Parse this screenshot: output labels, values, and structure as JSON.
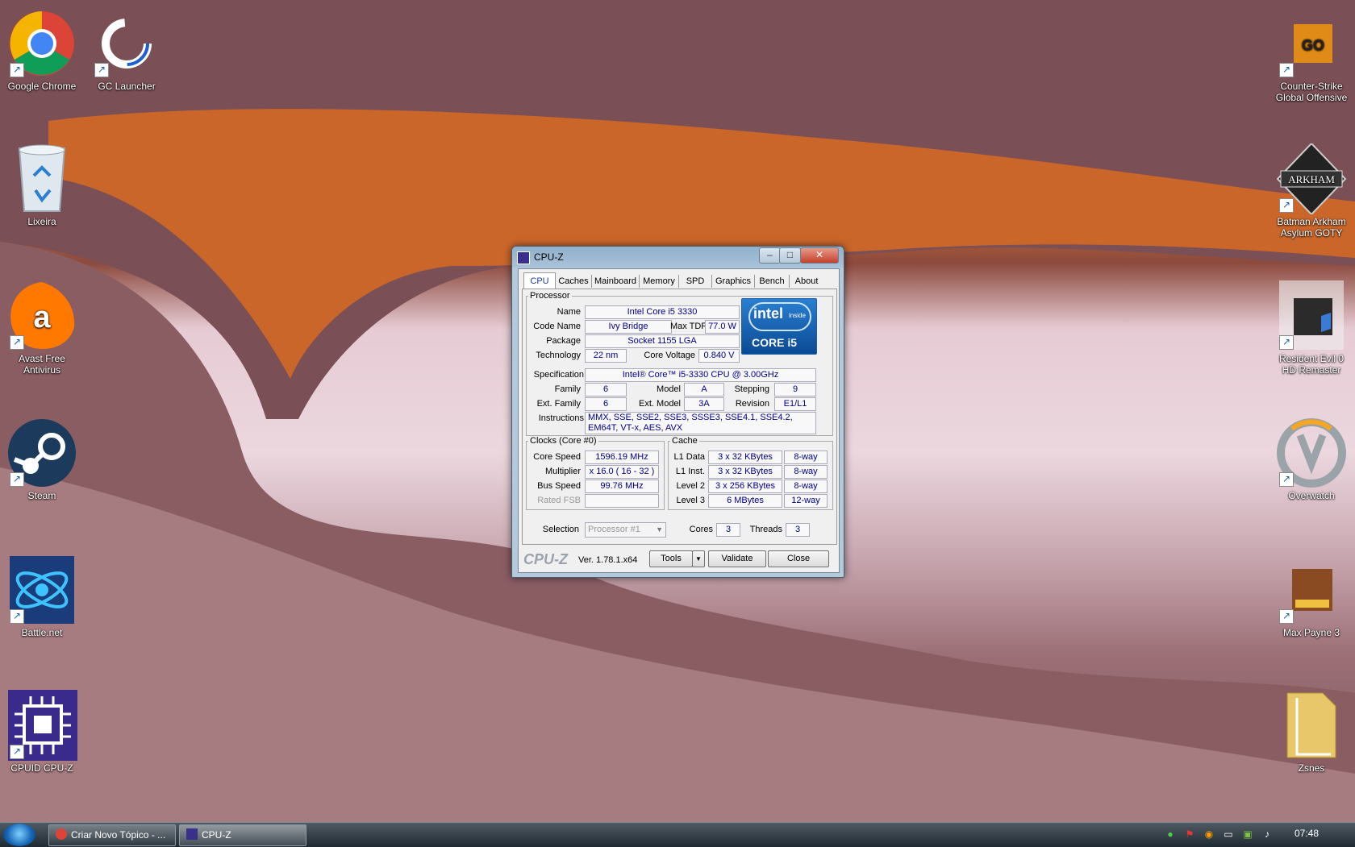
{
  "desktop": {
    "icons_left": [
      {
        "label": "Google Chrome"
      },
      {
        "label": "GC Launcher"
      },
      {
        "label": "Lixeira"
      },
      {
        "label": "Avast Free Antivirus"
      },
      {
        "label": "Steam"
      },
      {
        "label": "Battle.net"
      },
      {
        "label": "CPUID CPU-Z"
      }
    ],
    "icons_right": [
      {
        "label": "Counter-Strike Global Offensive"
      },
      {
        "label": "Batman Arkham Asylum GOTY"
      },
      {
        "label": "Resident Evil 0 HD Remaster"
      },
      {
        "label": "Overwatch"
      },
      {
        "label": "Max Payne 3"
      },
      {
        "label": "Zsnes"
      }
    ]
  },
  "window": {
    "title": "CPU-Z",
    "tabs": [
      "CPU",
      "Caches",
      "Mainboard",
      "Memory",
      "SPD",
      "Graphics",
      "Bench",
      "About"
    ],
    "processor": {
      "legend": "Processor",
      "name_label": "Name",
      "name": "Intel Core i5 3330",
      "codename_label": "Code Name",
      "codename": "Ivy Bridge",
      "tdp_label": "Max TDP",
      "tdp": "77.0 W",
      "package_label": "Package",
      "package": "Socket 1155 LGA",
      "tech_label": "Technology",
      "tech": "22 nm",
      "voltage_label": "Core Voltage",
      "voltage": "0.840 V",
      "spec_label": "Specification",
      "spec": "Intel® Core™ i5-3330 CPU @ 3.00GHz",
      "family_label": "Family",
      "family": "6",
      "model_label": "Model",
      "model": "A",
      "stepping_label": "Stepping",
      "stepping": "9",
      "extfamily_label": "Ext. Family",
      "extfamily": "6",
      "extmodel_label": "Ext. Model",
      "extmodel": "3A",
      "revision_label": "Revision",
      "revision": "E1/L1",
      "instr_label": "Instructions",
      "instr": "MMX, SSE, SSE2, SSE3, SSSE3, SSE4.1, SSE4.2, EM64T, VT-x, AES, AVX"
    },
    "logo": {
      "line1": "intel",
      "line2": "inside",
      "line3": "CORE i5"
    },
    "clocks": {
      "legend": "Clocks (Core #0)",
      "corespeed_label": "Core Speed",
      "corespeed": "1596.19 MHz",
      "multiplier_label": "Multiplier",
      "multiplier": "x 16.0 ( 16 - 32 )",
      "busspeed_label": "Bus Speed",
      "busspeed": "99.76 MHz",
      "ratedfsb_label": "Rated FSB",
      "ratedfsb": ""
    },
    "cache": {
      "legend": "Cache",
      "rows": [
        {
          "label": "L1 Data",
          "size": "3 x 32 KBytes",
          "way": "8-way"
        },
        {
          "label": "L1 Inst.",
          "size": "3 x 32 KBytes",
          "way": "8-way"
        },
        {
          "label": "Level 2",
          "size": "3 x 256 KBytes",
          "way": "8-way"
        },
        {
          "label": "Level 3",
          "size": "6 MBytes",
          "way": "12-way"
        }
      ]
    },
    "selection": {
      "label": "Selection",
      "value": "Processor #1",
      "cores_label": "Cores",
      "cores": "3",
      "threads_label": "Threads",
      "threads": "3"
    },
    "footer": {
      "brand": "CPU-Z",
      "version": "Ver. 1.78.1.x64",
      "tools": "Tools",
      "validate": "Validate",
      "close": "Close"
    }
  },
  "taskbar": {
    "tasks": [
      "Criar Novo Tópico - ...",
      "CPU-Z"
    ],
    "clock": "07:48"
  },
  "colors": {
    "accent_value_text": "#00008b",
    "taskbar": "#2b363f"
  }
}
